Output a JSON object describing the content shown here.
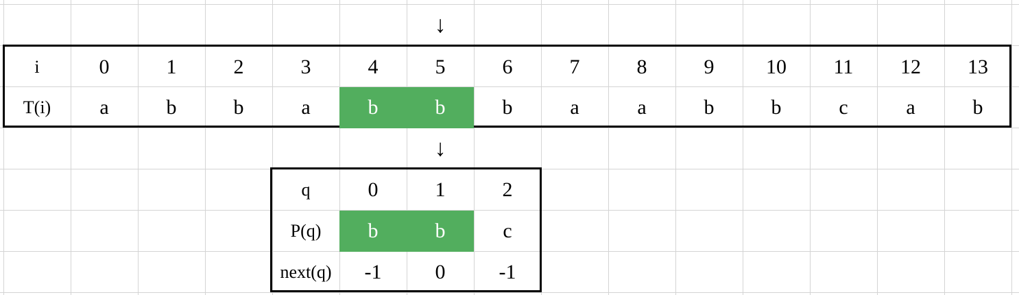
{
  "text_table": {
    "index_label": "i",
    "value_label": "T(i)",
    "indices": [
      "0",
      "1",
      "2",
      "3",
      "4",
      "5",
      "6",
      "7",
      "8",
      "9",
      "10",
      "11",
      "12",
      "13"
    ],
    "values": [
      "a",
      "b",
      "b",
      "a",
      "b",
      "b",
      "b",
      "a",
      "a",
      "b",
      "b",
      "c",
      "a",
      "b"
    ],
    "highlighted_columns": [
      4,
      5
    ]
  },
  "pattern_table": {
    "index_label": "q",
    "value_label": "P(q)",
    "next_label": "next(q)",
    "indices": [
      "0",
      "1",
      "2"
    ],
    "values": [
      "b",
      "b",
      "c"
    ],
    "next_values": [
      "-1",
      "0",
      "-1"
    ],
    "highlighted_columns": [
      0,
      1
    ]
  },
  "arrows": {
    "top": "↓",
    "bottom": "↓"
  },
  "colors": {
    "highlight": "#52ae5e",
    "highlight_text": "#ffffff",
    "border": "#000000",
    "grid": "#d4d4d4"
  }
}
